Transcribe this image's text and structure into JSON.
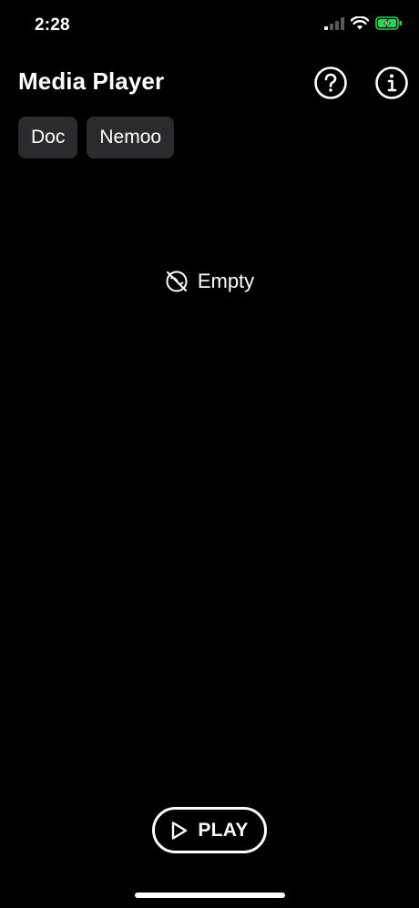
{
  "status_bar": {
    "time": "2:28",
    "icons": [
      "cellular-signal-icon",
      "wifi-icon",
      "battery-charging-icon"
    ],
    "battery_color": "#30d158"
  },
  "header": {
    "title": "Media Player",
    "help_icon": "question-circle-icon",
    "info_icon": "info-circle-icon"
  },
  "chips": [
    {
      "label": "Doc"
    },
    {
      "label": "Nemoo"
    }
  ],
  "empty_state": {
    "icon": "no-data-icon",
    "label": "Empty"
  },
  "play_button": {
    "icon": "play-icon",
    "label": "PLAY"
  },
  "colors": {
    "background": "#000000",
    "chip_background": "#2b2b2d",
    "text": "#ffffff"
  }
}
